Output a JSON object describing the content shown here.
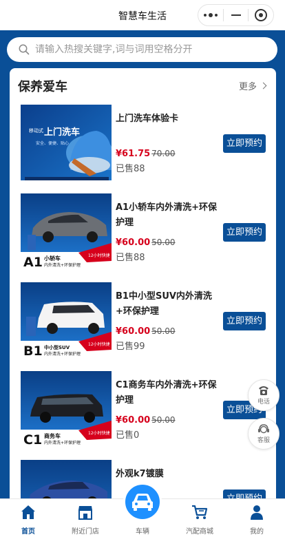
{
  "header": {
    "title": "智慧车生活"
  },
  "search": {
    "placeholder": "请输入热搜关键字,词与词用空格分开"
  },
  "section": {
    "title": "保养爱车",
    "more_label": "更多"
  },
  "products": [
    {
      "name": "上门洗车体验卡",
      "price": "¥61.75",
      "original_price": "70.00",
      "sold": "已售88",
      "button": "立即预约",
      "image_text": "移动式 上门洗车",
      "image_subtext": "安全、便捷、贴心"
    },
    {
      "name": "A1小轿车内外清洗+环保护理",
      "price": "¥60.00",
      "original_price": "50.00",
      "sold": "已售88",
      "button": "立即预约",
      "image_grade": "A1",
      "image_type": "小轿车",
      "image_service": "内外清洗+环保护理",
      "image_tag": "12小时快捷"
    },
    {
      "name": "B1中小型SUV内外清洗+环保护理",
      "price": "¥60.00",
      "original_price": "50.00",
      "sold": "已售99",
      "button": "立即预约",
      "image_grade": "B1",
      "image_type": "中小型SUV",
      "image_service": "内外清洗+环保护理",
      "image_tag": "12小时快捷"
    },
    {
      "name": "C1商务车内外清洗+环保护理",
      "price": "¥60.00",
      "original_price": "50.00",
      "sold": "已售0",
      "button": "立即预约",
      "image_grade": "C1",
      "image_type": "商务车",
      "image_service": "内外清洗+环保护理",
      "image_tag": "12小时快捷"
    },
    {
      "name": "外观k7镀膜",
      "price": "",
      "original_price": "",
      "sold": "",
      "button": "立即预约"
    }
  ],
  "floating": {
    "phone_label": "电话",
    "service_label": "客服"
  },
  "tabbar": {
    "items": [
      {
        "label": "首页",
        "icon": "home-icon",
        "active": true
      },
      {
        "label": "附近门店",
        "icon": "store-icon",
        "active": false
      },
      {
        "label": "车辆",
        "icon": "car-icon",
        "active": false
      },
      {
        "label": "汽配商城",
        "icon": "cart-icon",
        "active": false
      },
      {
        "label": "我的",
        "icon": "user-icon",
        "active": false
      }
    ]
  },
  "colors": {
    "brand_blue": "#0a4f97",
    "price_red": "#d6001c",
    "center_button": "#1e90ff"
  }
}
